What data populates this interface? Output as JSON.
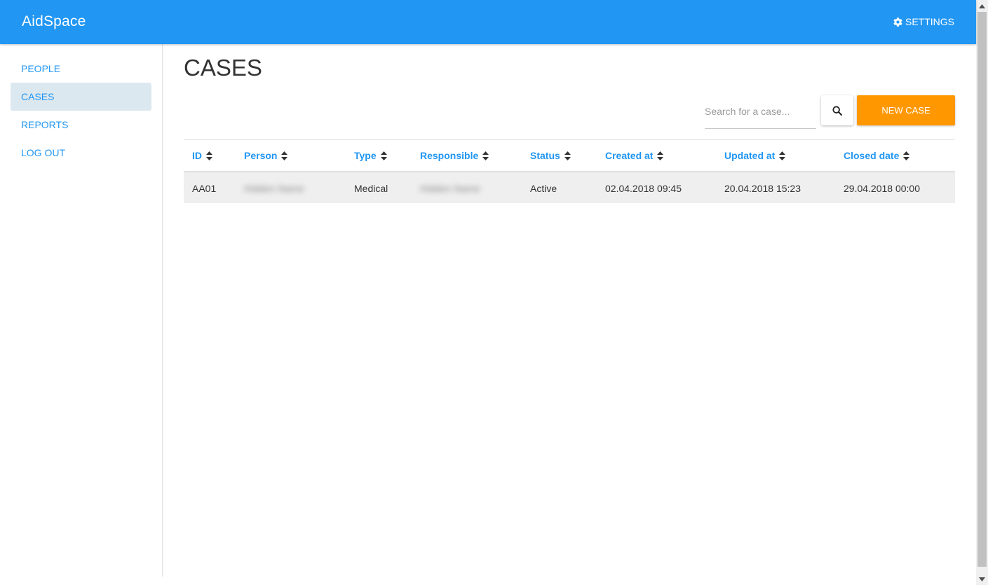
{
  "header": {
    "brand": "AidSpace",
    "settings_label": "SETTINGS",
    "settings_icon": "gear-icon"
  },
  "sidebar": {
    "items": [
      {
        "label": "PEOPLE",
        "active": false
      },
      {
        "label": "CASES",
        "active": true
      },
      {
        "label": "REPORTS",
        "active": false
      },
      {
        "label": "LOG OUT",
        "active": false
      }
    ]
  },
  "main": {
    "title": "CASES",
    "search": {
      "placeholder": "Search for a case...",
      "value": ""
    },
    "search_icon": "search-icon",
    "new_case_label": "NEW CASE"
  },
  "table": {
    "columns": [
      "ID",
      "Person",
      "Type",
      "Responsible",
      "Status",
      "Created at",
      "Updated at",
      "Closed date"
    ],
    "rows": [
      {
        "id": "AA01",
        "person": "Hidden Name",
        "type": "Medical",
        "responsible": "Hidden Name",
        "status": "Active",
        "created_at": "02.04.2018 09:45",
        "updated_at": "20.04.2018 15:23",
        "closed_date": "29.04.2018 00:00"
      }
    ]
  },
  "colors": {
    "primary": "#2196f3",
    "accent": "#ff9800",
    "active_nav_bg": "#dce8ef",
    "row_bg": "#efefef"
  }
}
